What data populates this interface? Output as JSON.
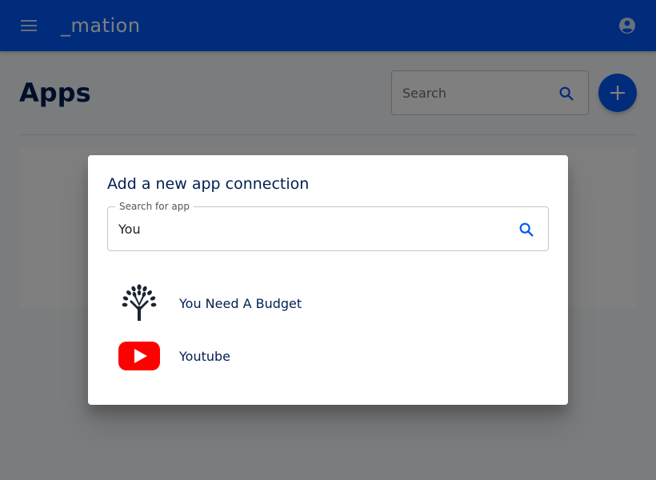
{
  "appbar": {
    "brand": "_mation",
    "menu_icon": "menu-icon",
    "account_icon": "account-circle-icon"
  },
  "page": {
    "title": "Apps",
    "search_placeholder": "Search",
    "add_icon": "plus-icon"
  },
  "dialog": {
    "title": "Add a new app connection",
    "search_label": "Search for app",
    "search_value": "You",
    "results": [
      {
        "name": "You Need A Budget",
        "icon": "ynab-tree-icon"
      },
      {
        "name": "Youtube",
        "icon": "youtube-icon"
      }
    ]
  },
  "colors": {
    "primary": "#0059f7",
    "title_text": "#001f52",
    "youtube_red": "#ff0000",
    "ynab_dark": "#1b2433"
  }
}
